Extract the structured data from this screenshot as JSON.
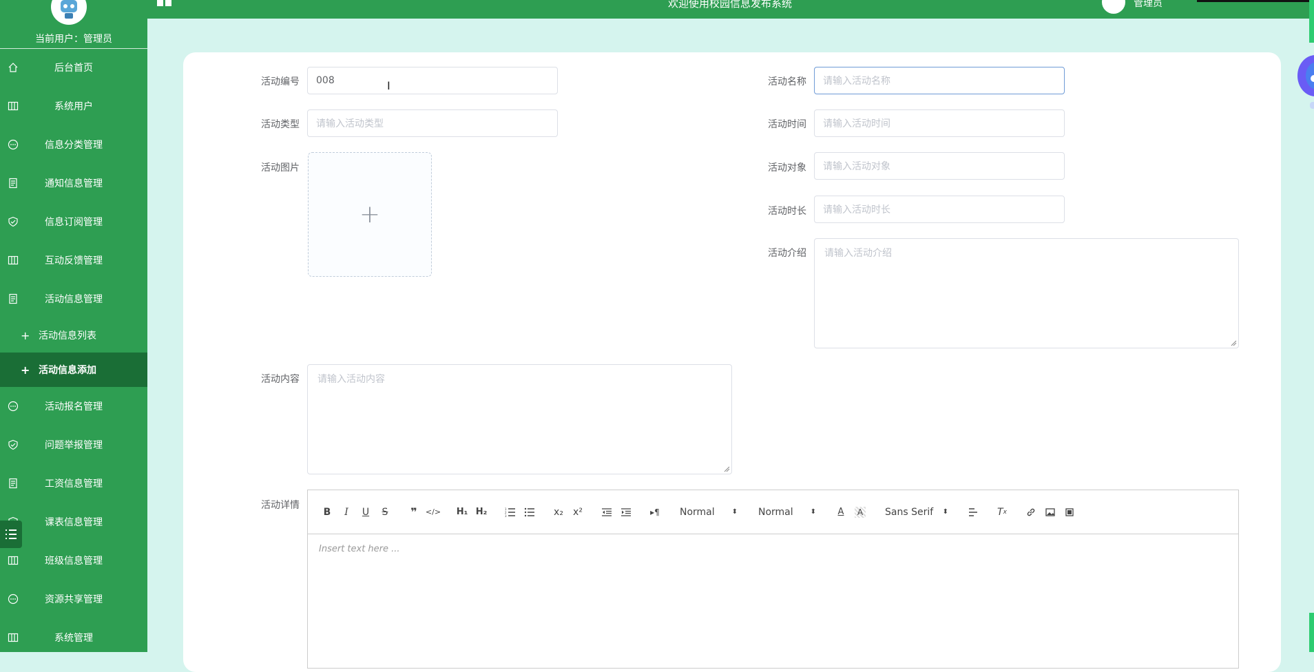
{
  "sidebar": {
    "current_user": "当前用户：管理员",
    "items": [
      {
        "label": "后台首页",
        "icon": "home-icon"
      },
      {
        "label": "系统用户",
        "icon": "columns-icon"
      },
      {
        "label": "信息分类管理",
        "icon": "chat-icon"
      },
      {
        "label": "通知信息管理",
        "icon": "document-icon"
      },
      {
        "label": "信息订阅管理",
        "icon": "shield-check-icon"
      },
      {
        "label": "互动反馈管理",
        "icon": "columns-icon"
      },
      {
        "label": "活动信息管理",
        "icon": "document-icon"
      }
    ],
    "sub_items": [
      {
        "label": "活动信息列表"
      },
      {
        "label": "活动信息添加"
      }
    ],
    "items2": [
      {
        "label": "活动报名管理",
        "icon": "chat-icon"
      },
      {
        "label": "问题举报管理",
        "icon": "shield-check-icon"
      },
      {
        "label": "工资信息管理",
        "icon": "document-icon"
      },
      {
        "label": "课表信息管理",
        "icon": "shield-check-icon"
      },
      {
        "label": "班级信息管理",
        "icon": "columns-icon"
      },
      {
        "label": "资源共享管理",
        "icon": "chat-icon"
      },
      {
        "label": "系统管理",
        "icon": "columns-icon"
      }
    ]
  },
  "header": {
    "title": "欢迎使用校园信息发布系统",
    "username": "管理员"
  },
  "form": {
    "activity_no": {
      "label": "活动编号",
      "value": "008"
    },
    "activity_name": {
      "label": "活动名称",
      "placeholder": "请输入活动名称"
    },
    "activity_type": {
      "label": "活动类型",
      "placeholder": "请输入活动类型"
    },
    "activity_time": {
      "label": "活动时间",
      "placeholder": "请输入活动时间"
    },
    "activity_image": {
      "label": "活动图片"
    },
    "activity_target": {
      "label": "活动对象",
      "placeholder": "请输入活动对象"
    },
    "activity_duration": {
      "label": "活动时长",
      "placeholder": "请输入活动时长"
    },
    "activity_intro": {
      "label": "活动介绍",
      "placeholder": "请输入活动介绍"
    },
    "activity_content": {
      "label": "活动内容",
      "placeholder": "请输入活动内容"
    },
    "activity_detail": {
      "label": "活动详情"
    }
  },
  "editor": {
    "header_select": "Normal",
    "size_select": "Normal",
    "font_select": "Sans Serif",
    "placeholder": "Insert text here ..."
  },
  "colors": {
    "sidebar": "#2e9e52",
    "sidebar_active": "#1a6e36",
    "background": "#d5f4ee"
  }
}
